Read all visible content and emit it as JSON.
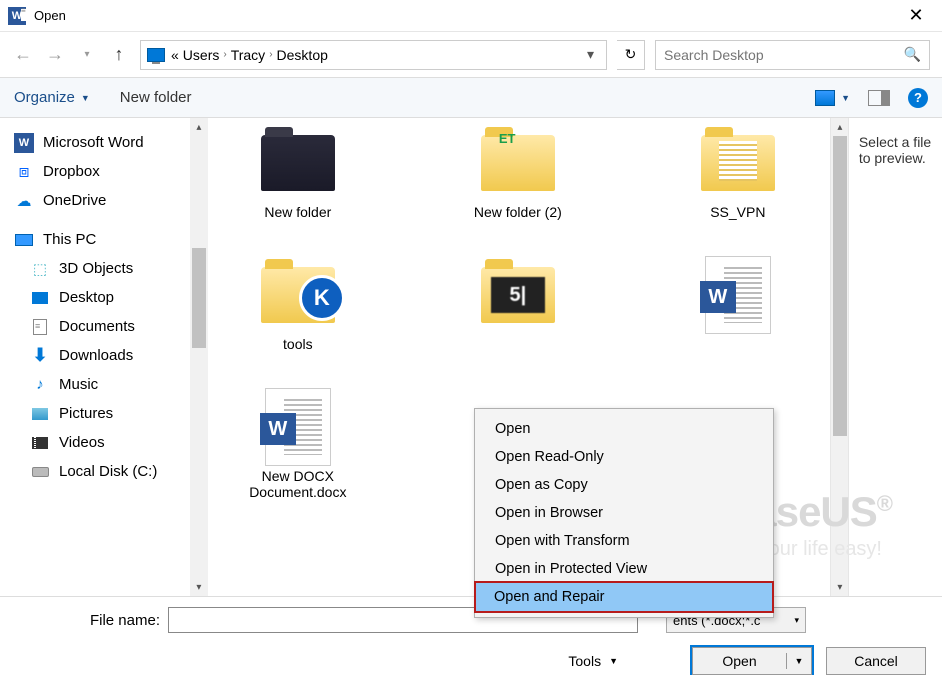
{
  "window": {
    "title": "Open"
  },
  "nav": {
    "crumb_prefix": "«",
    "crumbs": [
      "Users",
      "Tracy",
      "Desktop"
    ]
  },
  "search": {
    "placeholder": "Search Desktop"
  },
  "toolbar": {
    "organize": "Organize",
    "new_folder": "New folder"
  },
  "sidebar": {
    "favs": [
      {
        "label": "Microsoft Word",
        "icon": "word"
      },
      {
        "label": "Dropbox",
        "icon": "dropbox"
      },
      {
        "label": "OneDrive",
        "icon": "onedrive"
      }
    ],
    "pc_label": "This PC",
    "pc_items": [
      {
        "label": "3D Objects",
        "icon": "3d"
      },
      {
        "label": "Desktop",
        "icon": "desk"
      },
      {
        "label": "Documents",
        "icon": "doc"
      },
      {
        "label": "Downloads",
        "icon": "down"
      },
      {
        "label": "Music",
        "icon": "music"
      },
      {
        "label": "Pictures",
        "icon": "pic"
      },
      {
        "label": "Videos",
        "icon": "vid"
      },
      {
        "label": "Local Disk (C:)",
        "icon": "disk"
      }
    ]
  },
  "files": [
    {
      "label": "New folder",
      "kind": "folder-dark"
    },
    {
      "label": "New folder (2)",
      "kind": "folder-et"
    },
    {
      "label": "SS_VPN",
      "kind": "folder-ss"
    },
    {
      "label": "tools",
      "kind": "folder-k"
    },
    {
      "label": "",
      "kind": "folder-5"
    },
    {
      "label": "",
      "kind": "doc-word"
    },
    {
      "label": "New DOCX Document.docx",
      "kind": "doc-word"
    }
  ],
  "preview": {
    "text": "Select a file to preview."
  },
  "context_menu": {
    "items": [
      "Open",
      "Open Read-Only",
      "Open as Copy",
      "Open in Browser",
      "Open with Transform",
      "Open in Protected View",
      "Open and Repair"
    ],
    "highlighted": 6
  },
  "footer": {
    "file_name_label": "File name:",
    "file_name_value": "",
    "filter": "ents (*.docx;*.c",
    "tools": "Tools",
    "open": "Open",
    "cancel": "Cancel"
  },
  "watermark": {
    "brand": "EaseUS",
    "tagline": "Make your life easy!"
  }
}
